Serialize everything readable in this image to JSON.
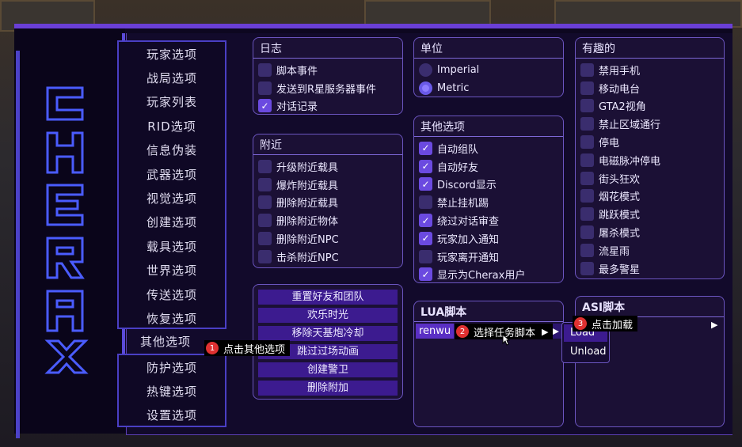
{
  "nav": {
    "top": [
      "玩家选项",
      "战局选项",
      "玩家列表",
      "RID选项",
      "信息伪装",
      "武器选项",
      "视觉选项",
      "创建选项",
      "载具选项",
      "世界选项",
      "传送选项",
      "恢复选项"
    ],
    "current": "其他选项",
    "bottom": [
      "防护选项",
      "热键选项",
      "设置选项"
    ]
  },
  "log": {
    "title": "日志",
    "items": [
      {
        "label": "脚本事件",
        "checked": false
      },
      {
        "label": "发送到R星服务器事件",
        "checked": false
      },
      {
        "label": "对话记录",
        "checked": true
      }
    ]
  },
  "nearby": {
    "title": "附近",
    "items": [
      {
        "label": "升级附近载具",
        "checked": false
      },
      {
        "label": "爆炸附近载具",
        "checked": false
      },
      {
        "label": "删除附近载具",
        "checked": false
      },
      {
        "label": "删除附近物体",
        "checked": false
      },
      {
        "label": "删除附近NPC",
        "checked": false
      },
      {
        "label": "击杀附近NPC",
        "checked": false
      }
    ]
  },
  "actions": [
    "重置好友和团队",
    "欢乐时光",
    "移除天基炮冷却",
    "跳过过场动画",
    "创建警卫",
    "删除附加"
  ],
  "units": {
    "title": "单位",
    "options": [
      {
        "label": "Imperial",
        "selected": false
      },
      {
        "label": "Metric",
        "selected": true
      }
    ]
  },
  "other": {
    "title": "其他选项",
    "items": [
      {
        "label": "自动组队",
        "checked": true
      },
      {
        "label": "自动好友",
        "checked": true
      },
      {
        "label": "Discord显示",
        "checked": true
      },
      {
        "label": "禁止挂机踢",
        "checked": false
      },
      {
        "label": "绕过对话审查",
        "checked": true
      },
      {
        "label": "玩家加入通知",
        "checked": true
      },
      {
        "label": "玩家离开通知",
        "checked": false
      },
      {
        "label": "显示为Cherax用户",
        "checked": true
      }
    ]
  },
  "fun": {
    "title": "有趣的",
    "items": [
      {
        "label": "禁用手机",
        "checked": false
      },
      {
        "label": "移动电台",
        "checked": false
      },
      {
        "label": "GTA2视角",
        "checked": false
      },
      {
        "label": "禁止区域通行",
        "checked": false
      },
      {
        "label": "停电",
        "checked": false
      },
      {
        "label": "电磁脉冲停电",
        "checked": false
      },
      {
        "label": "街头狂欢",
        "checked": false
      },
      {
        "label": "烟花模式",
        "checked": false
      },
      {
        "label": "跳跃模式",
        "checked": false
      },
      {
        "label": "屠杀模式",
        "checked": false
      },
      {
        "label": "流星雨",
        "checked": false
      },
      {
        "label": "最多警星",
        "checked": false
      }
    ]
  },
  "lua": {
    "title": "LUA脚本",
    "selected": "renwu"
  },
  "asi": {
    "title": "ASI脚本"
  },
  "dropdown": [
    "Load",
    "Unload"
  ],
  "tooltips": [
    {
      "num": "1",
      "text": "点击其他选项"
    },
    {
      "num": "2",
      "text": "选择任务脚本"
    },
    {
      "num": "3",
      "text": "点击加载"
    }
  ],
  "colors": {
    "accent": "#6a3fd6",
    "panel_border": "#6b55c0",
    "checked": "#6b4ae0",
    "badge": "#e03131",
    "logo_blue": "#4a5cff"
  }
}
